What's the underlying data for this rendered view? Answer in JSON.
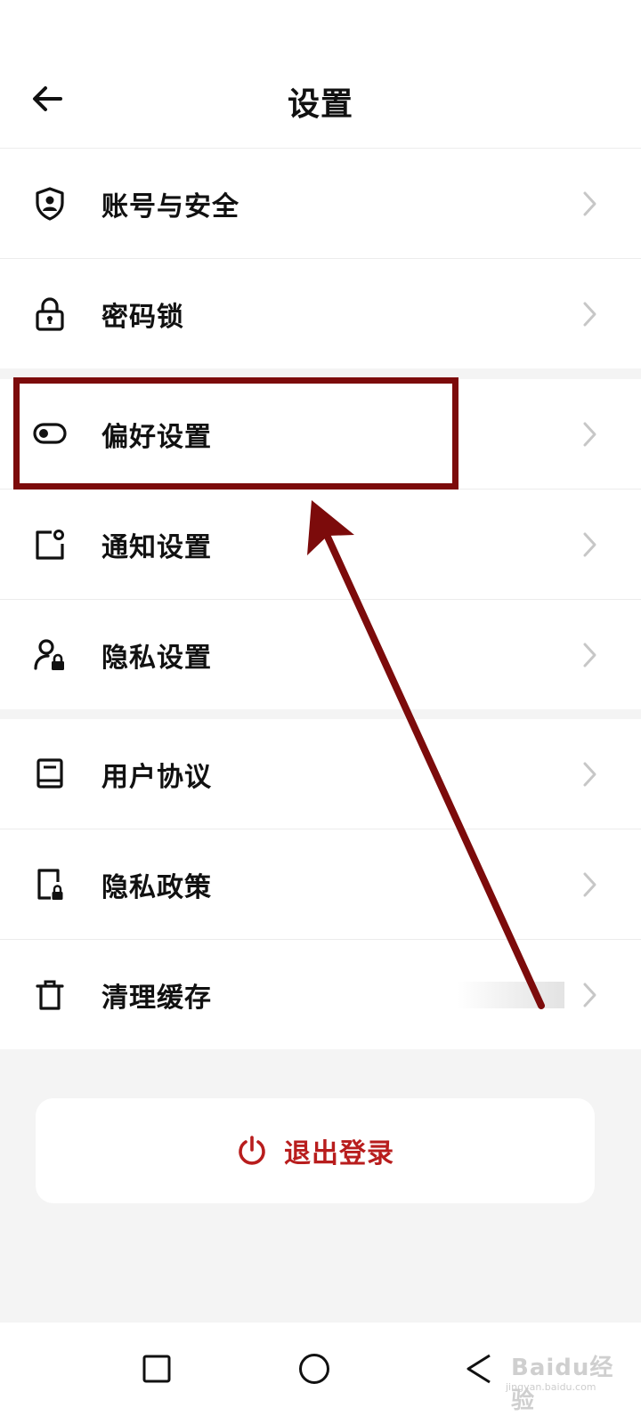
{
  "header": {
    "title": "设置"
  },
  "groups": {
    "account": [
      {
        "label": "账号与安全",
        "icon": "shield-user-icon"
      },
      {
        "label": "密码锁",
        "icon": "lock-icon"
      }
    ],
    "settings": [
      {
        "label": "偏好设置",
        "icon": "toggle-icon"
      },
      {
        "label": "通知设置",
        "icon": "notification-icon"
      },
      {
        "label": "隐私设置",
        "icon": "user-lock-icon"
      }
    ],
    "legal": [
      {
        "label": "用户协议",
        "icon": "book-icon"
      },
      {
        "label": "隐私政策",
        "icon": "privacy-doc-icon"
      },
      {
        "label": "清理缓存",
        "icon": "trash-icon"
      }
    ]
  },
  "logout": {
    "label": "退出登录",
    "icon": "power-icon",
    "color": "#b81d1d"
  },
  "navbar": {
    "icons": [
      "square-icon",
      "circle-icon",
      "triangle-back-icon"
    ]
  },
  "annotation": {
    "color": "#7c0b0b"
  },
  "watermark": {
    "main": "Baidu经验",
    "sub": "jingyan.baidu.com"
  }
}
